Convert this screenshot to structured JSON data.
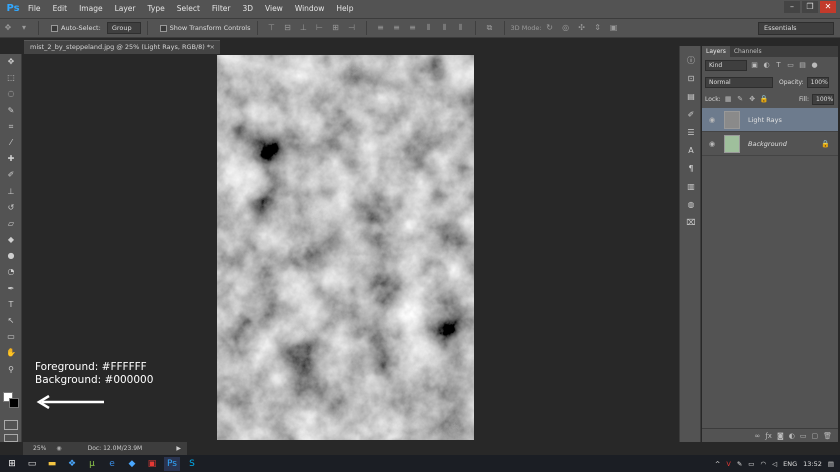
{
  "app": {
    "logo": "Ps",
    "menu": [
      "File",
      "Edit",
      "Image",
      "Layer",
      "Type",
      "Select",
      "Filter",
      "3D",
      "View",
      "Window",
      "Help"
    ],
    "window_controls": [
      "–",
      "❐",
      "✕"
    ]
  },
  "options_bar": {
    "auto_select_label": "Auto-Select:",
    "auto_select_target": "Group",
    "show_transform_label": "Show Transform Controls",
    "mode_3d_label": "3D Mode:",
    "workspace": "Essentials"
  },
  "document": {
    "tab_title": "mist_2_by_steppeland.jpg @ 25% (Light Rays, RGB/8) *",
    "close_glyph": "×"
  },
  "annotation": {
    "foreground": "Foreground: #FFFFFF",
    "background": "Background: #000000"
  },
  "colors": {
    "foreground": "#FFFFFF",
    "background": "#000000",
    "selected_layer": "#6d7b8d",
    "ps_accent": "#31a8ff"
  },
  "status": {
    "zoom": "25%",
    "doc_size": "Doc: 12.0M/23.9M"
  },
  "layers_panel": {
    "tabs": [
      "Layers",
      "Channels"
    ],
    "filter_label": "Kind",
    "blend_mode": "Normal",
    "opacity_label": "Opacity:",
    "opacity_value": "100%",
    "lock_label": "Lock:",
    "fill_label": "Fill:",
    "fill_value": "100%",
    "layers": [
      {
        "name": "Light Rays",
        "selected": true
      },
      {
        "name": "Background",
        "locked": true
      }
    ]
  },
  "taskbar": {
    "language": "ENG",
    "time": "13:52"
  }
}
